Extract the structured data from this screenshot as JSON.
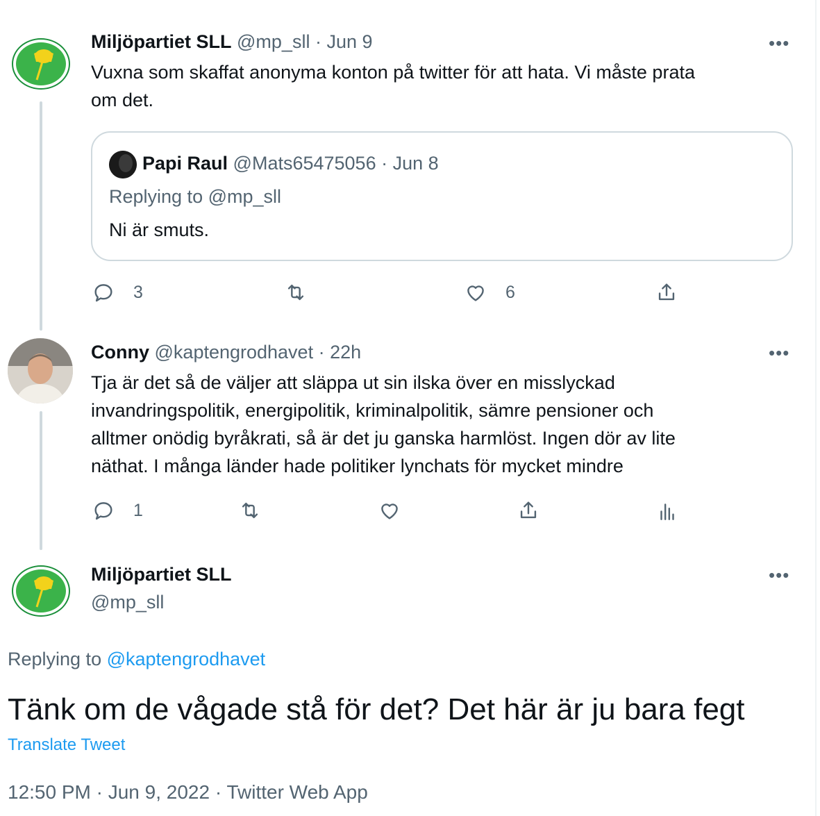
{
  "thread": {
    "tweet1": {
      "author_name": "Miljöpartiet SLL",
      "author_meta": "@mp_sll · Jun 9",
      "text_line1": "Vuxna som skaffat anonyma konton på twitter för att hata. Vi måste prata",
      "text_line2": "om det.",
      "more": "•••",
      "quote": {
        "author_name": "Papi Raul",
        "author_meta": "@Mats65475056 · Jun 8",
        "replying": "Replying to @mp_sll",
        "text": "Ni är smuts."
      },
      "actions": {
        "replies": "3",
        "likes": "6"
      }
    },
    "tweet2": {
      "author_name": "Conny",
      "author_meta": "@kaptengrodhavet · 22h",
      "more": "•••",
      "lines": [
        "Tja är det så de väljer att släppa ut sin ilska över en misslyckad",
        "invandringspolitik, energipolitik, kriminalpolitik, sämre pensioner och",
        "alltmer onödig byråkrati, så är det ju ganska harmlöst. Ingen dör av lite",
        "näthat. I många länder hade politiker lynchats för mycket mindre"
      ],
      "actions": {
        "replies": "1"
      }
    },
    "main": {
      "author_name": "Miljöpartiet SLL",
      "author_handle": "@mp_sll",
      "more": "•••",
      "replying_prefix": "Replying to",
      "replying_handle": "@kaptengrodhavet",
      "text": "Tänk om de vågade stå för det? Det här är ju bara fegt",
      "translate": "Translate Tweet",
      "timestamp": "12:50 PM · Jun 9, 2022 · Twitter Web App"
    }
  },
  "colors": {
    "accent": "#1d9bf0",
    "muted": "#536471",
    "border": "#cfd9de",
    "mp_green": "#1a8f3a",
    "mp_yellow": "#f2d21b"
  },
  "icons": [
    "reply-icon",
    "retweet-icon",
    "like-icon",
    "share-icon",
    "analytics-icon",
    "more-icon"
  ]
}
